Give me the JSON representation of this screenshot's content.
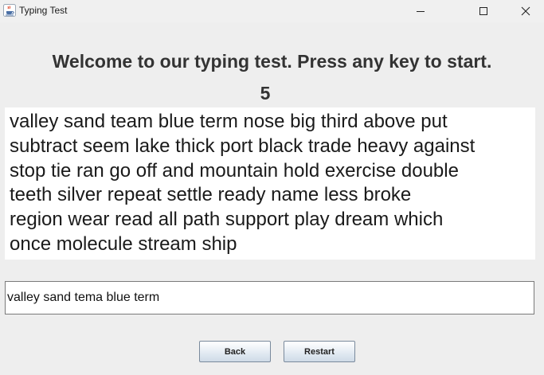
{
  "window": {
    "title": "Typing Test",
    "icon": "java-coffee-cup-icon",
    "controls": {
      "minimize_icon": "minimize-icon",
      "maximize_icon": "maximize-icon",
      "close_icon": "close-icon"
    }
  },
  "main": {
    "heading": "Welcome to our typing test. Press any key to start.",
    "counter": "5",
    "passage_lines": [
      "valley sand team blue term nose big third above put",
      "subtract seem lake thick port black trade heavy against",
      "stop tie ran go off and mountain hold exercise double",
      "teeth silver repeat settle ready name less broke",
      "region wear read all path support play dream which",
      "once molecule stream ship"
    ],
    "input_value": "valley sand tema blue term"
  },
  "buttons": {
    "back_label": "Back",
    "restart_label": "Restart"
  },
  "colors": {
    "background": "#eeeeee",
    "text": "#333333",
    "button_gradient_bottom": "#cfdbe7",
    "button_border": "#7a8a9c"
  }
}
